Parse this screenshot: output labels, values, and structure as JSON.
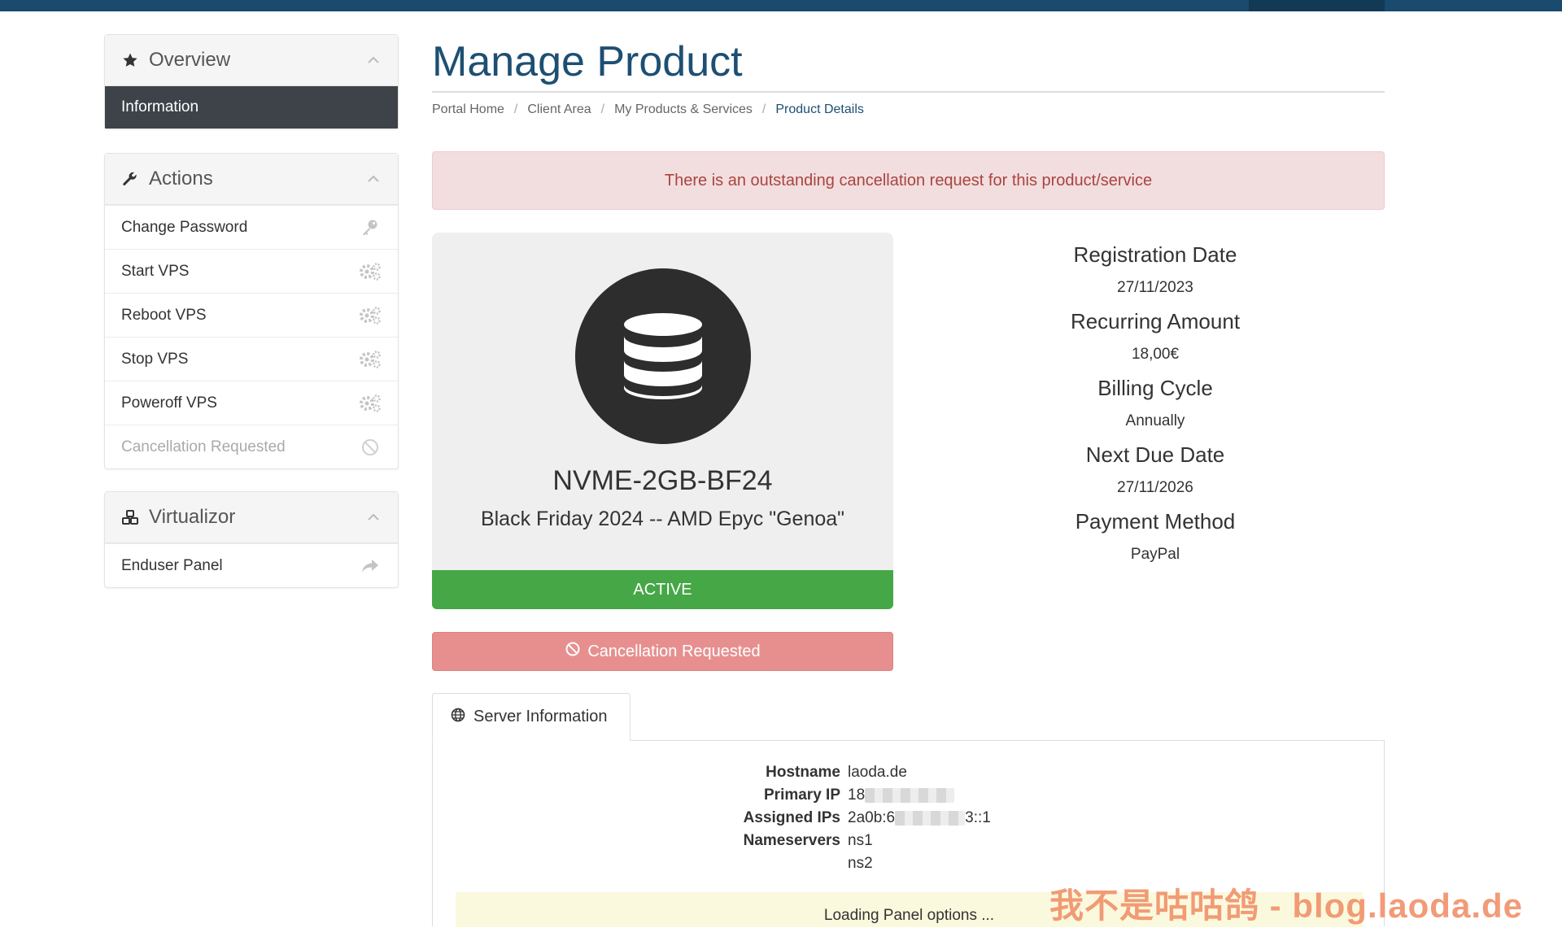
{
  "sidebar": {
    "overview": {
      "title": "Overview",
      "active_item": "Information"
    },
    "actions": {
      "title": "Actions",
      "items": [
        {
          "label": "Change Password",
          "icon": "key-icon"
        },
        {
          "label": "Start VPS",
          "icon": "gears-icon"
        },
        {
          "label": "Reboot VPS",
          "icon": "gears-icon"
        },
        {
          "label": "Stop VPS",
          "icon": "gears-icon"
        },
        {
          "label": "Poweroff VPS",
          "icon": "gears-icon"
        },
        {
          "label": "Cancellation Requested",
          "icon": "ban-icon",
          "disabled": true
        }
      ]
    },
    "virtualizor": {
      "title": "Virtualizor",
      "items": [
        {
          "label": "Enduser Panel",
          "icon": "share-icon"
        }
      ]
    }
  },
  "main": {
    "title": "Manage Product",
    "breadcrumb": [
      "Portal Home",
      "Client Area",
      "My Products & Services",
      "Product Details"
    ],
    "alert": "There is an outstanding cancellation request for this product/service",
    "product": {
      "name": "NVME-2GB-BF24",
      "group": "Black Friday 2024 -- AMD Epyc \"Genoa\"",
      "status": "ACTIVE",
      "icon": "database-icon"
    },
    "cancel_button": "Cancellation Requested",
    "details": [
      {
        "label": "Registration Date",
        "value": "27/11/2023"
      },
      {
        "label": "Recurring Amount",
        "value": "18,00€"
      },
      {
        "label": "Billing Cycle",
        "value": "Annually"
      },
      {
        "label": "Next Due Date",
        "value": "27/11/2026"
      },
      {
        "label": "Payment Method",
        "value": "PayPal"
      }
    ],
    "server_tab": "Server Information",
    "server": {
      "hostname_label": "Hostname",
      "hostname": "laoda.de",
      "primary_ip_label": "Primary IP",
      "primary_ip_prefix": "18",
      "assigned_ips_label": "Assigned IPs",
      "assigned_ips_prefix": "2a0b:6",
      "assigned_ips_suffix": "3::1",
      "nameservers_label": "Nameservers",
      "ns1": "ns1",
      "ns2": "ns2"
    },
    "loading_text": "Loading Panel options ..."
  },
  "watermark": "我不是咕咕鸽 - blog.laoda.de",
  "colors": {
    "brand": "#1d4f73",
    "active": "#46a747",
    "danger": "#e78f8f",
    "alert_bg": "#f2dede"
  }
}
